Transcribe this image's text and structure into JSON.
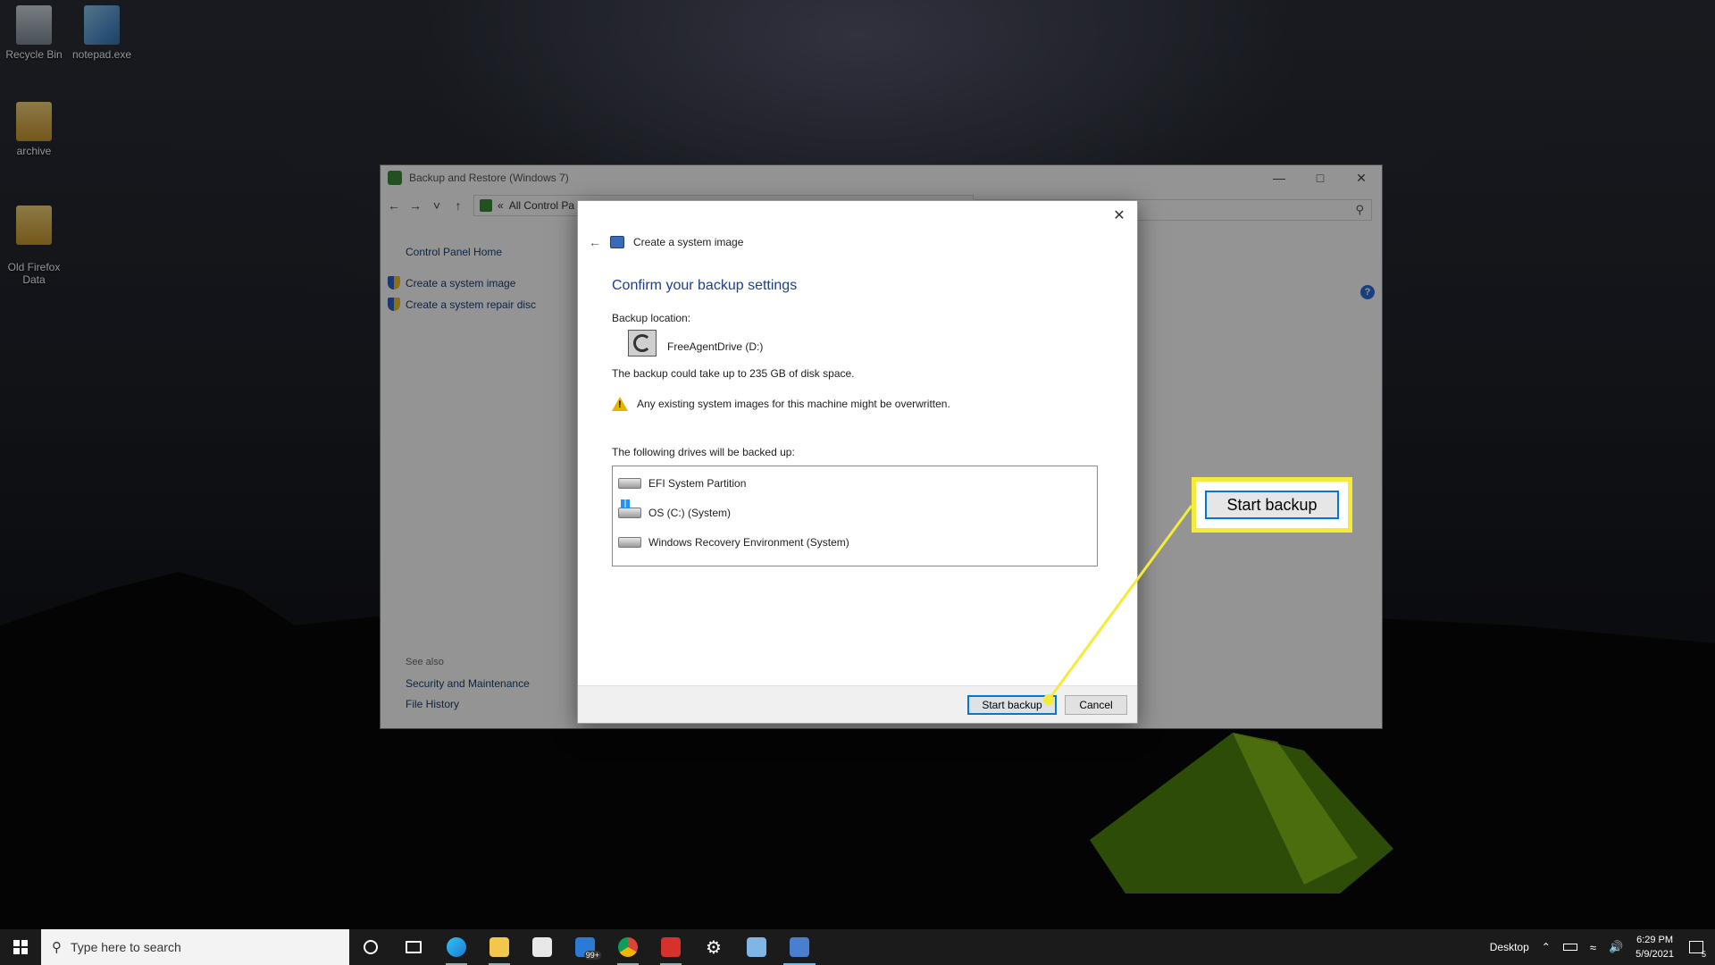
{
  "desktop": {
    "icons": [
      {
        "label": "Recycle Bin"
      },
      {
        "label": "notepad.exe"
      },
      {
        "label": "archive"
      },
      {
        "label": "Old Firefox\nData"
      }
    ]
  },
  "main_window": {
    "title": "Backup and Restore (Windows 7)",
    "address": "All Control Pa",
    "sidebar": {
      "home": "Control Panel Home",
      "links": [
        "Create a system image",
        "Create a system repair disc"
      ],
      "see_also_title": "See also",
      "see_also_links": [
        "Security and Maintenance",
        "File History"
      ]
    }
  },
  "dialog": {
    "title": "Create a system image",
    "heading": "Confirm your backup settings",
    "backup_location_label": "Backup location:",
    "drive_name": "FreeAgentDrive (D:)",
    "space_note": "The backup could take up to 235 GB of disk space.",
    "warning": "Any existing system images for this machine might be overwritten.",
    "drives_label": "The following drives will be backed up:",
    "drives": [
      {
        "name": "EFI System Partition",
        "icon": "drive-icon"
      },
      {
        "name": "OS (C:) (System)",
        "icon": "windows-drive-icon"
      },
      {
        "name": "Windows Recovery Environment (System)",
        "icon": "drive-icon"
      }
    ],
    "start_label": "Start backup",
    "cancel_label": "Cancel"
  },
  "callout": {
    "label": "Start backup",
    "highlight_color": "#f4eb3a"
  },
  "taskbar": {
    "search_placeholder": "Type here to search",
    "mail_badge": "99+",
    "desktop_label": "Desktop",
    "time": "6:29 PM",
    "date": "5/9/2021",
    "notification_count": "5"
  },
  "colors": {
    "accent": "#0078d7",
    "heading_blue": "#1d3f8a",
    "link_blue": "#1a3e72"
  }
}
